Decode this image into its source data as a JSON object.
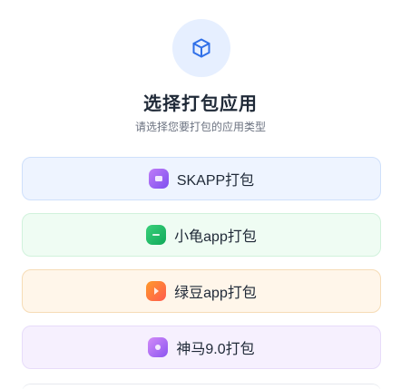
{
  "header": {
    "icon": "cube-icon",
    "accent_color": "#2f6fe8",
    "title": "选择打包应用",
    "subtitle": "请选择您要打包的应用类型"
  },
  "options": [
    {
      "label": "SKAPP打包",
      "icon": "app-icon",
      "color": "#8b5cf6"
    },
    {
      "label": "小龟app打包",
      "icon": "app-icon",
      "color": "#16a34a"
    },
    {
      "label": "绿豆app打包",
      "icon": "app-icon",
      "color": "#f97316"
    },
    {
      "label": "神马9.0打包",
      "icon": "app-icon",
      "color": "#a855f7"
    }
  ]
}
